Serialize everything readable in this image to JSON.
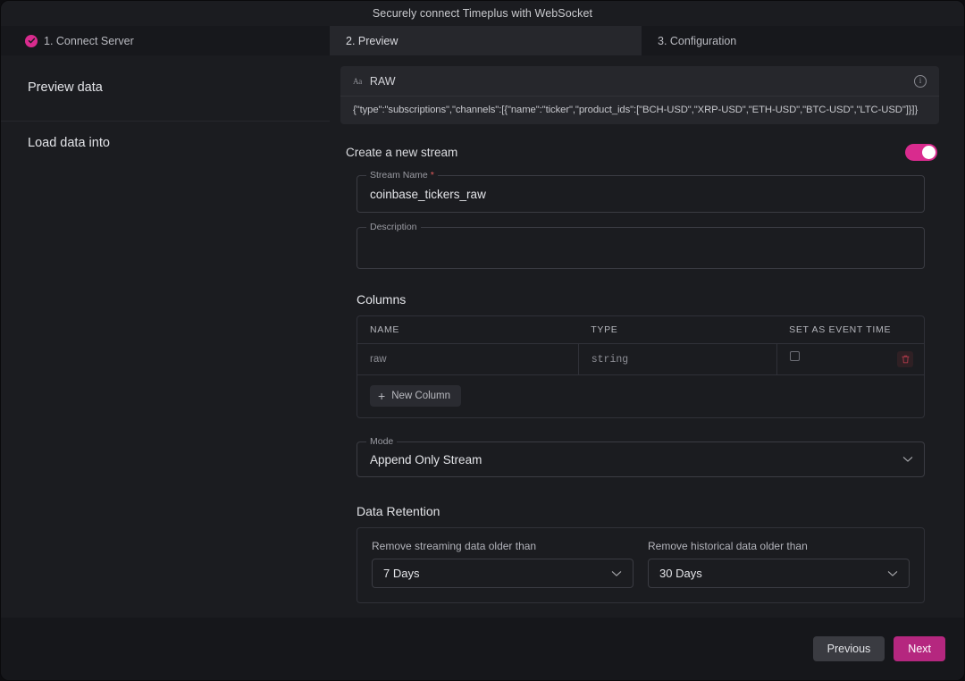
{
  "window": {
    "title": "Securely connect Timeplus with WebSocket"
  },
  "tabs": [
    {
      "label": "1. Connect Server",
      "state": "completed",
      "icon": "check-circle-icon"
    },
    {
      "label": "2. Preview",
      "state": "active"
    },
    {
      "label": "3. Configuration",
      "state": "upcoming"
    }
  ],
  "sections": {
    "preview_data_label": "Preview data",
    "load_data_into_label": "Load data into"
  },
  "preview": {
    "format_icon": "text-format-icon",
    "format_label": "RAW",
    "info_icon": "info-icon",
    "raw_line": "{\"type\":\"subscriptions\",\"channels\":[{\"name\":\"ticker\",\"product_ids\":[\"BCH-USD\",\"XRP-USD\",\"ETH-USD\",\"BTC-USD\",\"LTC-USD\"]}]}"
  },
  "create_stream": {
    "label": "Create a new stream",
    "toggle_on": true,
    "toggle_color": "#d92b8e",
    "stream_name": {
      "legend": "Stream Name",
      "required_marker": "*",
      "value": "coinbase_tickers_raw"
    },
    "description": {
      "legend": "Description",
      "value": ""
    }
  },
  "columns": {
    "title": "Columns",
    "headers": [
      "NAME",
      "TYPE",
      "SET AS EVENT TIME"
    ],
    "rows": [
      {
        "name": "raw",
        "type": "string",
        "event_time_checked": false,
        "delete_icon": "trash-icon"
      }
    ],
    "new_column_label": "New Column",
    "type_color": "#9b7ae8"
  },
  "mode": {
    "legend": "Mode",
    "value": "Append Only Stream",
    "chevron_icon": "chevron-down-icon"
  },
  "data_retention": {
    "title": "Data Retention",
    "streaming": {
      "label": "Remove streaming data older than",
      "value": "7 Days"
    },
    "historical": {
      "label": "Remove historical data older than",
      "value": "30 Days"
    }
  },
  "footer": {
    "previous_label": "Previous",
    "next_label": "Next",
    "next_color": "#b5277f"
  }
}
